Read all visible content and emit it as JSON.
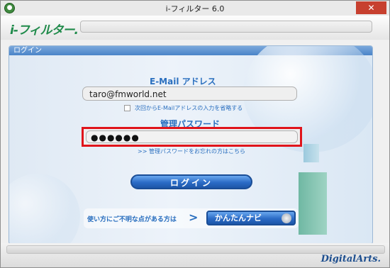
{
  "window": {
    "title": "i-フィルター 6.0",
    "close_glyph": "✕"
  },
  "logo": {
    "text": "i-フィルター."
  },
  "panel": {
    "header_label": "ログイン"
  },
  "form": {
    "email_label": "E-Mail アドレス",
    "email_value": "taro@fmworld.net",
    "remember_label": "次回からE-Mailアドレスの入力を省略する",
    "password_label": "管理パスワード",
    "password_value": "●●●●●●",
    "forgot_link": ">> 管理パスワードをお忘れの方はこちら",
    "login_button": "ログイン"
  },
  "help": {
    "text": "使い方にご不明な点がある方は",
    "arrow": ">",
    "navi_button": "かんたんナビ"
  },
  "footer": {
    "brand": "DigitalArts."
  },
  "colors": {
    "accent": "#2a6fbf",
    "highlight": "#e0141b",
    "logo_green": "#1f8a4a"
  }
}
